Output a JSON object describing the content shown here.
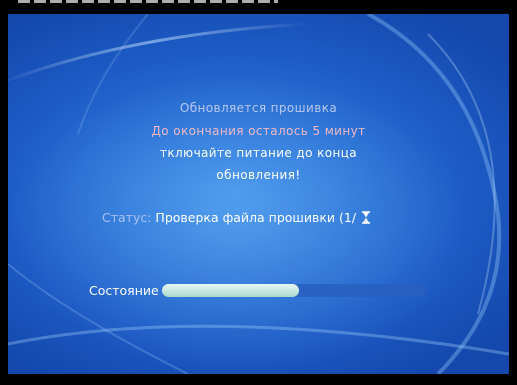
{
  "message": {
    "line1": "Обновляется прошивка",
    "line2": "До окончания осталось 5 минут",
    "line3": "тключайте питание до конца",
    "line4": "обновления!"
  },
  "status": {
    "label": "Статус:",
    "value": "Проверка файла прошивки (1/",
    "icon": "hourglass-icon"
  },
  "progress": {
    "label": "Состояние",
    "fraction": 0.52
  },
  "colors": {
    "background": "#2a72d6",
    "progress_fill": "#c5e8dd",
    "warning_text": "#f2b8c4"
  }
}
